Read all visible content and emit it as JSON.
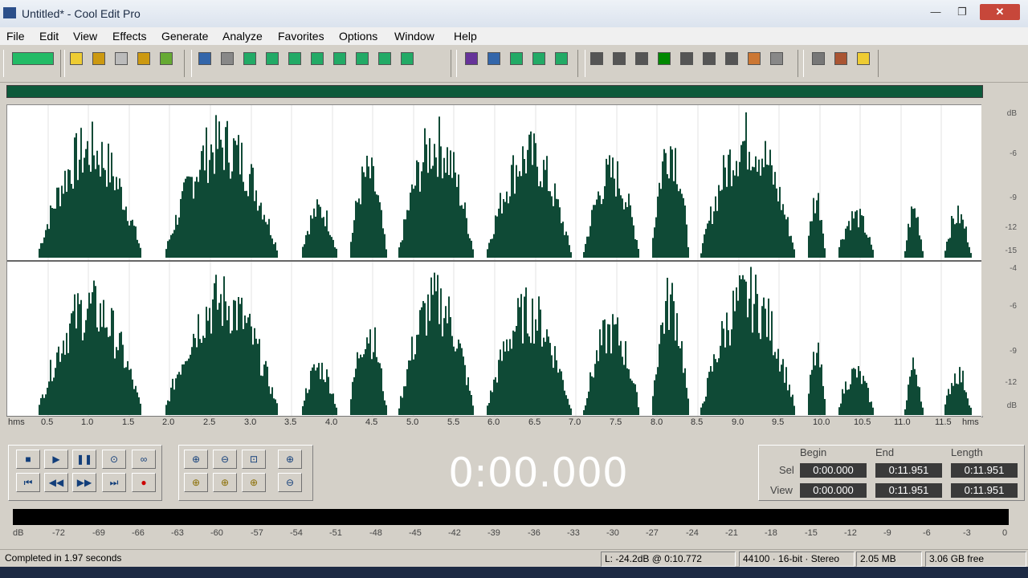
{
  "window": {
    "title": "Untitled* - Cool Edit Pro",
    "minimize_glyph": "—",
    "maximize_glyph": "❐",
    "close_glyph": "✕"
  },
  "menu": [
    "File",
    "Edit",
    "View",
    "Effects",
    "Generate",
    "Analyze",
    "Favorites",
    "Options",
    "Window",
    "Help"
  ],
  "toolbar_icons": [
    "toggle-waveform-multitrack-icon",
    "new-file-icon",
    "open-file-icon",
    "save-icon",
    "save-as-icon",
    "close-icon",
    "undo-icon",
    "redo-icon",
    "cut-selection-icon",
    "trim-icon",
    "copy-icon",
    "cut-icon",
    "paste-icon",
    "paste-new-icon",
    "mix-paste-icon",
    "find-icon",
    "spectral-view-icon",
    "edit-view-icon",
    "snap-grid-icon",
    "zero-cross-icon",
    "markers-icon",
    "cue-list-icon",
    "playlist-icon",
    "settings-icon",
    "play-icon",
    "zoom-icon",
    "time-format-icon",
    "meter-icon",
    "color-icon",
    "frame-icon",
    "scripts-icon",
    "tools-icon",
    "help-icon"
  ],
  "db_scale_top": [
    "dB",
    "-6",
    "-9",
    "-12",
    "-15"
  ],
  "db_scale_bottom": [
    "-4",
    "-6",
    "-9",
    "-12",
    "dB"
  ],
  "time_ruler": [
    "hms",
    "0.5",
    "1.0",
    "1.5",
    "2.0",
    "2.5",
    "3.0",
    "3.5",
    "4.0",
    "4.5",
    "5.0",
    "5.5",
    "6.0",
    "6.5",
    "7.0",
    "7.5",
    "8.0",
    "8.5",
    "9.0",
    "9.5",
    "10.0",
    "10.5",
    "11.0",
    "11.5",
    "hms"
  ],
  "colors": {
    "waveform": "#0f4a36",
    "background": "#f8f8f8",
    "overview": "#0d5a3b"
  },
  "transport": {
    "row1": [
      "■",
      "▶",
      "❚❚",
      "⊙",
      "∞"
    ],
    "row2": [
      "⏮",
      "◀◀",
      "▶▶",
      "⏭",
      "●"
    ],
    "zoom_row1": [
      "⊕",
      "⊖",
      "⊡"
    ],
    "zoom_row2": [
      "⊕",
      "⊕",
      "⊕"
    ],
    "zoom_extra": [
      "⊕",
      "⊖"
    ]
  },
  "time_display": "0:00.000",
  "selection": {
    "headers": [
      "Begin",
      "End",
      "Length"
    ],
    "rows": [
      {
        "label": "Sel",
        "begin": "0:00.000",
        "end": "0:11.951",
        "length": "0:11.951"
      },
      {
        "label": "View",
        "begin": "0:00.000",
        "end": "0:11.951",
        "length": "0:11.951"
      }
    ]
  },
  "level_meter": [
    "dB",
    "-72",
    "-69",
    "-66",
    "-63",
    "-60",
    "-57",
    "-54",
    "-51",
    "-48",
    "-45",
    "-42",
    "-39",
    "-36",
    "-33",
    "-30",
    "-27",
    "-24",
    "-21",
    "-18",
    "-15",
    "-12",
    "-9",
    "-6",
    "-3",
    "0"
  ],
  "status": {
    "message": "Completed in 1.97 seconds",
    "cursor": "L: -24.2dB @  0:10.772",
    "format": "44100 · 16-bit · Stereo",
    "size": "2.05 MB",
    "free": "3.06 GB free"
  }
}
